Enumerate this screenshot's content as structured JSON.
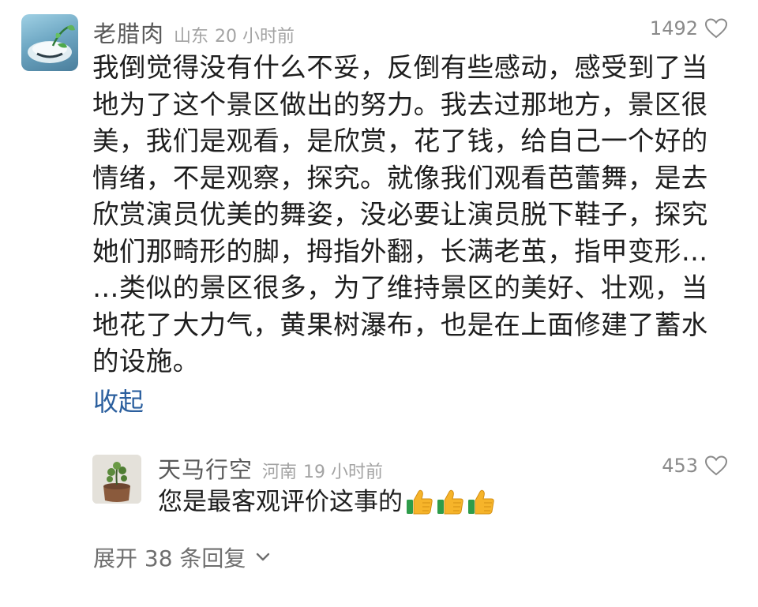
{
  "comment": {
    "username": "老腊肉",
    "location": "山东",
    "time": "20 小时前",
    "likes": "1492",
    "text": "我倒觉得没有什么不妥，反倒有些感动，感受到了当\n地为了这个景区做出的努力。我去过那地方，景区很\n美，我们是观看，是欣赏，花了钱，给自己一个好的\n情绪，不是观察，探究。就像我们观看芭蕾舞，是去\n欣赏演员优美的舞姿，没必要让演员脱下鞋子，探究\n她们那畸形的脚，拇指外翻，长满老茧，指甲变形…\n…类似的景区很多，为了维持景区的美好、壮观，当\n地花了大力气，黄果树瀑布，也是在上面修建了蓄水\n的设施。",
    "collapse_label": "收起",
    "avatar_icon": "plant-bowl-avatar"
  },
  "reply": {
    "username": "天马行空",
    "location": "河南",
    "time": "19 小时前",
    "likes": "453",
    "text": "您是最客观评价这事的",
    "emoji": [
      "thumbs-up-icon",
      "thumbs-up-icon",
      "thumbs-up-icon"
    ],
    "avatar_icon": "potted-plant-avatar"
  },
  "expand": {
    "label": "展开 38 条回复"
  },
  "colors": {
    "link": "#2b5f9e",
    "meta": "#a3a3a3",
    "username": "#5a5a5a",
    "text": "#1e1e1e"
  }
}
